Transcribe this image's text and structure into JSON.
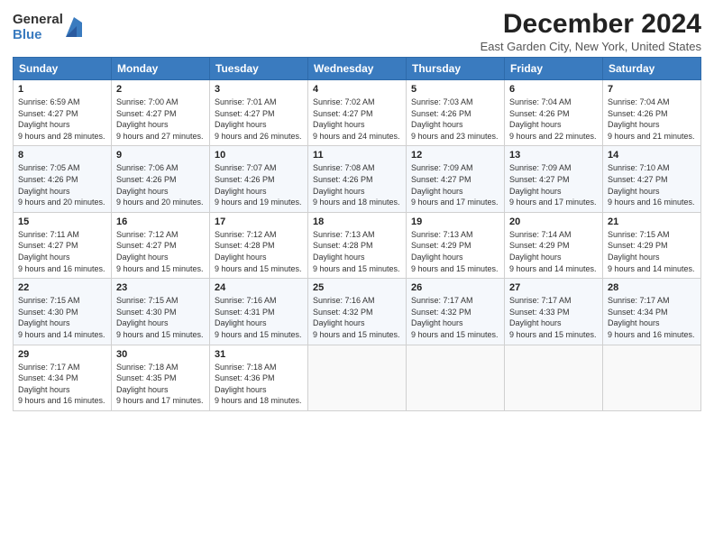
{
  "logo": {
    "general": "General",
    "blue": "Blue"
  },
  "title": "December 2024",
  "location": "East Garden City, New York, United States",
  "days_header": [
    "Sunday",
    "Monday",
    "Tuesday",
    "Wednesday",
    "Thursday",
    "Friday",
    "Saturday"
  ],
  "weeks": [
    [
      {
        "day": "1",
        "sunrise": "6:59 AM",
        "sunset": "4:27 PM",
        "daylight": "9 hours and 28 minutes."
      },
      {
        "day": "2",
        "sunrise": "7:00 AM",
        "sunset": "4:27 PM",
        "daylight": "9 hours and 27 minutes."
      },
      {
        "day": "3",
        "sunrise": "7:01 AM",
        "sunset": "4:27 PM",
        "daylight": "9 hours and 26 minutes."
      },
      {
        "day": "4",
        "sunrise": "7:02 AM",
        "sunset": "4:27 PM",
        "daylight": "9 hours and 24 minutes."
      },
      {
        "day": "5",
        "sunrise": "7:03 AM",
        "sunset": "4:26 PM",
        "daylight": "9 hours and 23 minutes."
      },
      {
        "day": "6",
        "sunrise": "7:04 AM",
        "sunset": "4:26 PM",
        "daylight": "9 hours and 22 minutes."
      },
      {
        "day": "7",
        "sunrise": "7:04 AM",
        "sunset": "4:26 PM",
        "daylight": "9 hours and 21 minutes."
      }
    ],
    [
      {
        "day": "8",
        "sunrise": "7:05 AM",
        "sunset": "4:26 PM",
        "daylight": "9 hours and 20 minutes."
      },
      {
        "day": "9",
        "sunrise": "7:06 AM",
        "sunset": "4:26 PM",
        "daylight": "9 hours and 20 minutes."
      },
      {
        "day": "10",
        "sunrise": "7:07 AM",
        "sunset": "4:26 PM",
        "daylight": "9 hours and 19 minutes."
      },
      {
        "day": "11",
        "sunrise": "7:08 AM",
        "sunset": "4:26 PM",
        "daylight": "9 hours and 18 minutes."
      },
      {
        "day": "12",
        "sunrise": "7:09 AM",
        "sunset": "4:27 PM",
        "daylight": "9 hours and 17 minutes."
      },
      {
        "day": "13",
        "sunrise": "7:09 AM",
        "sunset": "4:27 PM",
        "daylight": "9 hours and 17 minutes."
      },
      {
        "day": "14",
        "sunrise": "7:10 AM",
        "sunset": "4:27 PM",
        "daylight": "9 hours and 16 minutes."
      }
    ],
    [
      {
        "day": "15",
        "sunrise": "7:11 AM",
        "sunset": "4:27 PM",
        "daylight": "9 hours and 16 minutes."
      },
      {
        "day": "16",
        "sunrise": "7:12 AM",
        "sunset": "4:27 PM",
        "daylight": "9 hours and 15 minutes."
      },
      {
        "day": "17",
        "sunrise": "7:12 AM",
        "sunset": "4:28 PM",
        "daylight": "9 hours and 15 minutes."
      },
      {
        "day": "18",
        "sunrise": "7:13 AM",
        "sunset": "4:28 PM",
        "daylight": "9 hours and 15 minutes."
      },
      {
        "day": "19",
        "sunrise": "7:13 AM",
        "sunset": "4:29 PM",
        "daylight": "9 hours and 15 minutes."
      },
      {
        "day": "20",
        "sunrise": "7:14 AM",
        "sunset": "4:29 PM",
        "daylight": "9 hours and 14 minutes."
      },
      {
        "day": "21",
        "sunrise": "7:15 AM",
        "sunset": "4:29 PM",
        "daylight": "9 hours and 14 minutes."
      }
    ],
    [
      {
        "day": "22",
        "sunrise": "7:15 AM",
        "sunset": "4:30 PM",
        "daylight": "9 hours and 14 minutes."
      },
      {
        "day": "23",
        "sunrise": "7:15 AM",
        "sunset": "4:30 PM",
        "daylight": "9 hours and 15 minutes."
      },
      {
        "day": "24",
        "sunrise": "7:16 AM",
        "sunset": "4:31 PM",
        "daylight": "9 hours and 15 minutes."
      },
      {
        "day": "25",
        "sunrise": "7:16 AM",
        "sunset": "4:32 PM",
        "daylight": "9 hours and 15 minutes."
      },
      {
        "day": "26",
        "sunrise": "7:17 AM",
        "sunset": "4:32 PM",
        "daylight": "9 hours and 15 minutes."
      },
      {
        "day": "27",
        "sunrise": "7:17 AM",
        "sunset": "4:33 PM",
        "daylight": "9 hours and 15 minutes."
      },
      {
        "day": "28",
        "sunrise": "7:17 AM",
        "sunset": "4:34 PM",
        "daylight": "9 hours and 16 minutes."
      }
    ],
    [
      {
        "day": "29",
        "sunrise": "7:17 AM",
        "sunset": "4:34 PM",
        "daylight": "9 hours and 16 minutes."
      },
      {
        "day": "30",
        "sunrise": "7:18 AM",
        "sunset": "4:35 PM",
        "daylight": "9 hours and 17 minutes."
      },
      {
        "day": "31",
        "sunrise": "7:18 AM",
        "sunset": "4:36 PM",
        "daylight": "9 hours and 18 minutes."
      },
      null,
      null,
      null,
      null
    ]
  ],
  "labels": {
    "sunrise": "Sunrise:",
    "sunset": "Sunset:",
    "daylight": "Daylight hours"
  }
}
